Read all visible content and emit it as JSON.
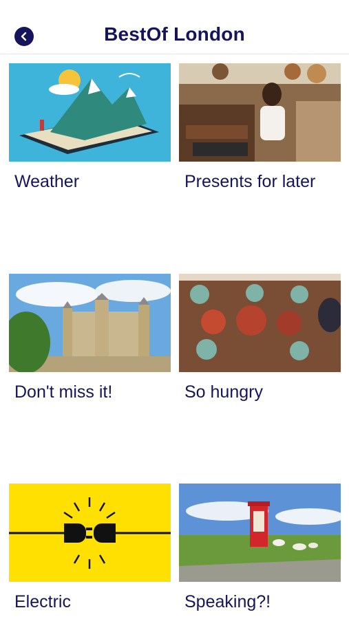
{
  "header": {
    "title": "BestOf London",
    "back_icon": "chevron-left-icon"
  },
  "cards": [
    {
      "label": "Weather",
      "image": "weather-illustration"
    },
    {
      "label": "Presents for later",
      "image": "market-shopping-photo"
    },
    {
      "label": "Don't miss it!",
      "image": "tower-of-london-photo"
    },
    {
      "label": "So hungry",
      "image": "dinner-table-photo"
    },
    {
      "label": "Electric",
      "image": "plug-socket-illustration"
    },
    {
      "label": "Speaking?!",
      "image": "red-phone-box-photo"
    }
  ],
  "colors": {
    "primary": "#16145a",
    "divider": "#e2e2e2"
  }
}
